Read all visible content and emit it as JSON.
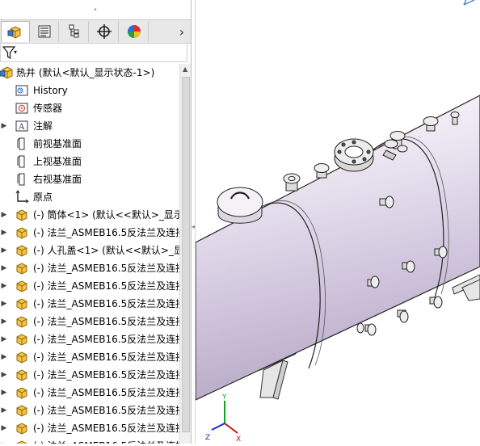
{
  "toolbar": {
    "grip": "•",
    "tabs": [
      {
        "name": "featuremanager-tab",
        "icon": "feature-tree-icon"
      },
      {
        "name": "propertymanager-tab",
        "icon": "property-list-icon"
      },
      {
        "name": "configurationmanager-tab",
        "icon": "configuration-icon"
      },
      {
        "name": "dimxpert-tab",
        "icon": "crosshair-icon"
      },
      {
        "name": "display-manager-tab",
        "icon": "appearance-pie-icon"
      }
    ],
    "more": "›"
  },
  "filter": {
    "icon": "filter-icon",
    "arrow": "▾"
  },
  "tree": {
    "root": {
      "label": "热井  (默认<默认_显示状态-1>)",
      "icon": "assembly-icon"
    },
    "items": [
      {
        "label": "History",
        "icon": "history-icon",
        "expand": ""
      },
      {
        "label": "传感器",
        "icon": "sensor-icon",
        "expand": ""
      },
      {
        "label": "注解",
        "icon": "annotation-icon",
        "expand": "▶"
      },
      {
        "label": "前视基准面",
        "icon": "plane-icon",
        "expand": ""
      },
      {
        "label": "上视基准面",
        "icon": "plane-icon",
        "expand": ""
      },
      {
        "label": "右视基准面",
        "icon": "plane-icon",
        "expand": ""
      },
      {
        "label": "原点",
        "icon": "origin-icon",
        "expand": ""
      },
      {
        "label": "(-) 筒体<1> (默认<<默认>_显示",
        "icon": "part-icon",
        "expand": "▶"
      },
      {
        "label": "(-) 法兰_ASMEB16.5反法兰及连接",
        "icon": "part-icon",
        "expand": "▶"
      },
      {
        "label": "(-) 人孔盖<1> (默认<<默认>_显",
        "icon": "part-icon",
        "expand": "▶"
      },
      {
        "label": "(-) 法兰_ASMEB16.5反法兰及连接",
        "icon": "part-icon",
        "expand": "▶"
      },
      {
        "label": "(-) 法兰_ASMEB16.5反法兰及连接",
        "icon": "part-icon",
        "expand": "▶"
      },
      {
        "label": "(-) 法兰_ASMEB16.5反法兰及连接",
        "icon": "part-icon",
        "expand": "▶"
      },
      {
        "label": "(-) 法兰_ASMEB16.5反法兰及连接",
        "icon": "part-icon",
        "expand": "▶"
      },
      {
        "label": "(-) 法兰_ASMEB16.5反法兰及连接",
        "icon": "part-icon",
        "expand": "▶"
      },
      {
        "label": "(-) 法兰_ASMEB16.5反法兰及连接",
        "icon": "part-icon",
        "expand": "▶"
      },
      {
        "label": "(-) 法兰_ASMEB16.5反法兰及连接",
        "icon": "part-icon",
        "expand": "▶"
      },
      {
        "label": "(-) 法兰_ASMEB16.5反法兰及连接",
        "icon": "part-icon",
        "expand": "▶"
      },
      {
        "label": "(-) 法兰_ASMEB16.5反法兰及连接",
        "icon": "part-icon",
        "expand": "▶"
      },
      {
        "label": "(-) 法兰_ASMEB16.5反法兰及连接",
        "icon": "part-icon",
        "expand": "▶"
      },
      {
        "label": "(-) 法兰_ASMEB16.5反法兰及连接",
        "icon": "part-icon",
        "expand": "▶"
      }
    ]
  },
  "scrollbar": {
    "up": "▲",
    "splitter_grip": "◂"
  },
  "viewport": {
    "triad": {
      "x": "X",
      "y": "Y",
      "z": "Z"
    },
    "colors": {
      "shell": "#d6cde0",
      "shell_dark": "#b9aec6",
      "edge": "#000000",
      "panel_bg": "#ffffff",
      "triad_x": "#d01010",
      "triad_y": "#10a020",
      "triad_z": "#1030d0"
    }
  }
}
